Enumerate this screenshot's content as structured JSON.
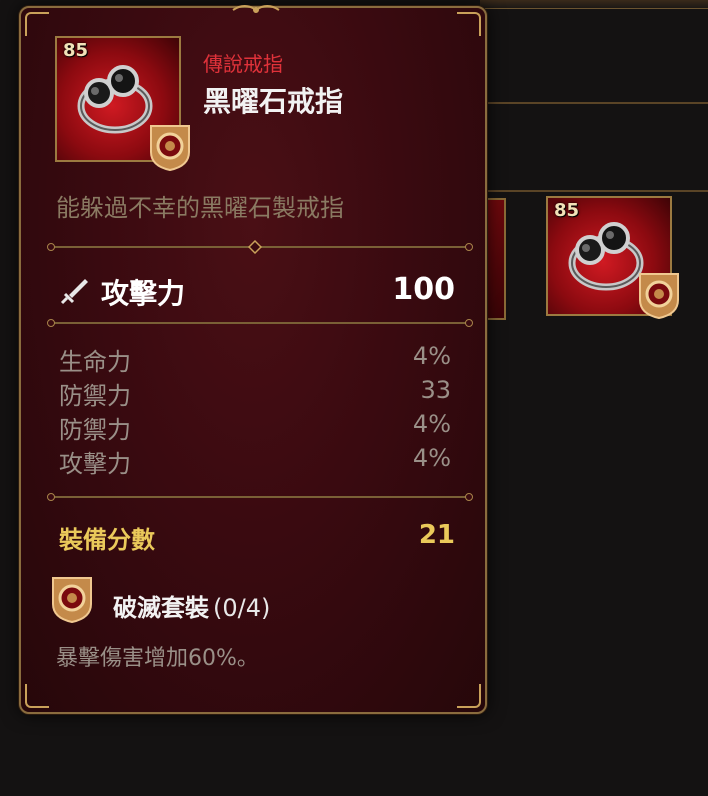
{
  "item": {
    "level": "85",
    "rarity": "傳說戒指",
    "name": "黑曜石戒指",
    "description": "能躲過不幸的黑曜石製戒指",
    "icon": "obsidian-ring-icon",
    "set_icon": "destruction-set-emblem-icon"
  },
  "main_stat": {
    "icon": "sword-icon",
    "label": "攻擊力",
    "value": "100"
  },
  "sub_stats": [
    {
      "label": "生命力",
      "value": "4%"
    },
    {
      "label": "防禦力",
      "value": "33"
    },
    {
      "label": "防禦力",
      "value": "4%"
    },
    {
      "label": "攻擊力",
      "value": "4%"
    }
  ],
  "score": {
    "label": "裝備分數",
    "value": "21"
  },
  "set": {
    "name": "破滅套裝",
    "count": "(0/4)",
    "effect": "暴擊傷害增加60%。"
  },
  "background_slot": {
    "level": "85"
  },
  "colors": {
    "rarity": "#e0323a",
    "score": "#eac95a",
    "frame": "#8a6c3e",
    "panel": "#3a0a10"
  }
}
